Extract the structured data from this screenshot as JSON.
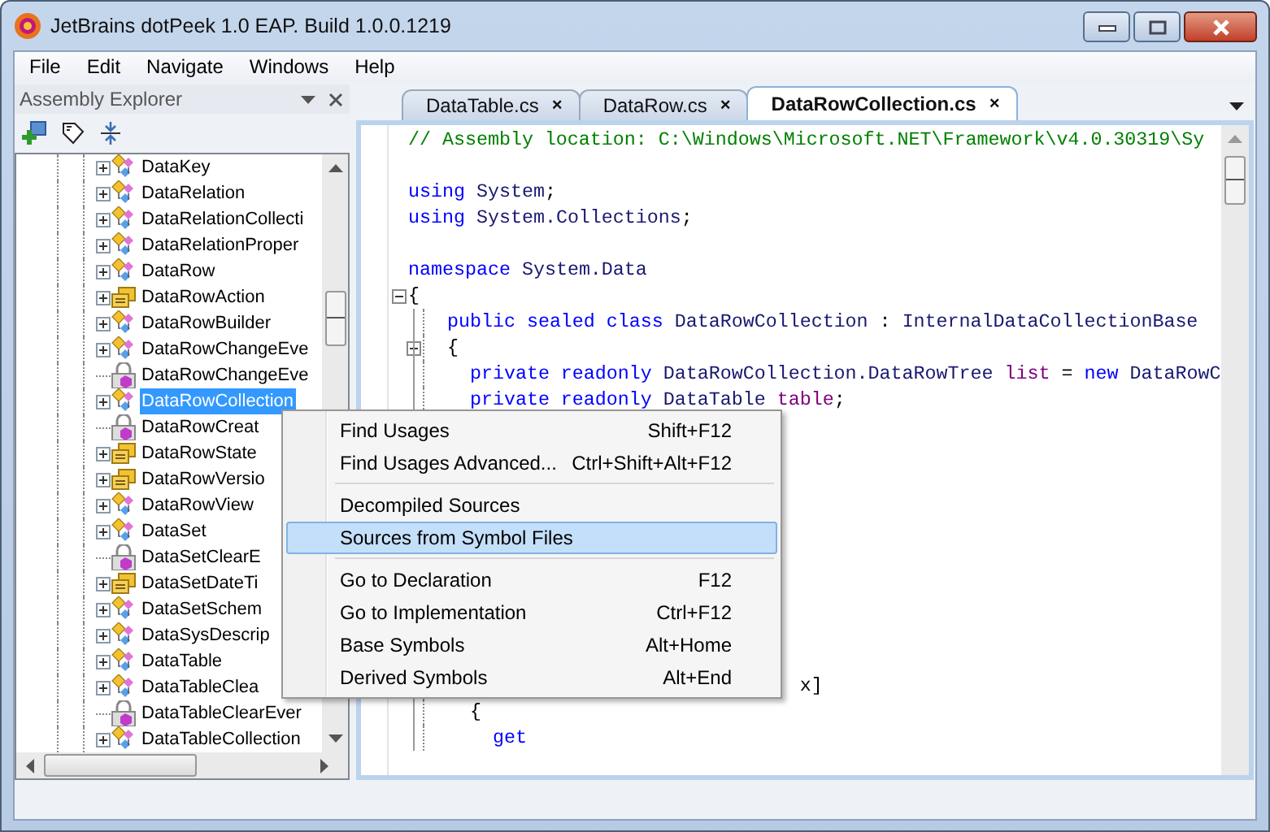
{
  "window": {
    "title": "JetBrains dotPeek 1.0 EAP. Build 1.0.0.1219"
  },
  "menu_bar": [
    "File",
    "Edit",
    "Navigate",
    "Windows",
    "Help"
  ],
  "assembly_explorer": {
    "title": "Assembly Explorer",
    "tree": [
      {
        "label": "DataKey",
        "kind": "class",
        "expandable": true,
        "selected": false
      },
      {
        "label": "DataRelation",
        "kind": "class",
        "expandable": true,
        "selected": false
      },
      {
        "label": "DataRelationCollecti",
        "kind": "class",
        "expandable": true,
        "selected": false
      },
      {
        "label": "DataRelationProper",
        "kind": "class",
        "expandable": true,
        "selected": false
      },
      {
        "label": "DataRow",
        "kind": "class",
        "expandable": true,
        "selected": false
      },
      {
        "label": "DataRowAction",
        "kind": "enum",
        "expandable": true,
        "selected": false
      },
      {
        "label": "DataRowBuilder",
        "kind": "class",
        "expandable": true,
        "selected": false
      },
      {
        "label": "DataRowChangeEve",
        "kind": "class",
        "expandable": true,
        "selected": false
      },
      {
        "label": "DataRowChangeEve",
        "kind": "delegate",
        "expandable": false,
        "selected": false
      },
      {
        "label": "DataRowCollection",
        "kind": "class",
        "expandable": true,
        "selected": true
      },
      {
        "label": "DataRowCreat",
        "kind": "delegate",
        "expandable": false,
        "selected": false
      },
      {
        "label": "DataRowState",
        "kind": "enum",
        "expandable": true,
        "selected": false
      },
      {
        "label": "DataRowVersio",
        "kind": "enum",
        "expandable": true,
        "selected": false
      },
      {
        "label": "DataRowView",
        "kind": "class",
        "expandable": true,
        "selected": false
      },
      {
        "label": "DataSet",
        "kind": "class",
        "expandable": true,
        "selected": false
      },
      {
        "label": "DataSetClearE",
        "kind": "delegate",
        "expandable": false,
        "selected": false
      },
      {
        "label": "DataSetDateTi",
        "kind": "enum",
        "expandable": true,
        "selected": false
      },
      {
        "label": "DataSetSchem",
        "kind": "class",
        "expandable": true,
        "selected": false
      },
      {
        "label": "DataSysDescrip",
        "kind": "class",
        "expandable": true,
        "selected": false
      },
      {
        "label": "DataTable",
        "kind": "class",
        "expandable": true,
        "selected": false
      },
      {
        "label": "DataTableClea",
        "kind": "class",
        "expandable": true,
        "selected": false
      },
      {
        "label": "DataTableClearEver",
        "kind": "delegate",
        "expandable": false,
        "selected": false
      },
      {
        "label": "DataTableCollection",
        "kind": "class",
        "expandable": true,
        "selected": false
      }
    ]
  },
  "tabs": [
    {
      "label": "DataTable.cs",
      "close": "×",
      "selected": false
    },
    {
      "label": "DataRow.cs",
      "close": "×",
      "selected": false
    },
    {
      "label": "DataRowCollection.cs",
      "close": "×",
      "selected": true
    }
  ],
  "code_lines": [
    {
      "kind": "code",
      "tokens": [
        {
          "t": "// Assembly location: C:\\Windows\\Microsoft.NET\\Framework\\v4.0.30319\\Sy",
          "kind": "comment"
        }
      ]
    },
    {
      "kind": "blank"
    },
    {
      "kind": "code",
      "tokens": [
        {
          "t": "using",
          "kind": "keyword"
        },
        {
          "t": " System",
          "kind": "type"
        },
        {
          "t": ";",
          "kind": "plain"
        }
      ]
    },
    {
      "kind": "code",
      "tokens": [
        {
          "t": "using",
          "kind": "keyword"
        },
        {
          "t": " System.Collections",
          "kind": "type"
        },
        {
          "t": ";",
          "kind": "plain"
        }
      ]
    },
    {
      "kind": "blank"
    },
    {
      "kind": "code",
      "tokens": [
        {
          "t": "namespace",
          "kind": "keyword"
        },
        {
          "t": " System.Data",
          "kind": "type"
        }
      ]
    },
    {
      "kind": "code",
      "fold": true,
      "tokens": [
        {
          "t": "{",
          "kind": "plain"
        }
      ]
    },
    {
      "kind": "code",
      "tokens": [
        {
          "t": "  public sealed class",
          "kind": "keyword"
        },
        {
          "t": " DataRowCollection",
          "kind": "type"
        },
        {
          "t": " : ",
          "kind": "plain"
        },
        {
          "t": "InternalDataCollectionBase",
          "kind": "type"
        }
      ]
    },
    {
      "kind": "code",
      "fold": true,
      "tokens": [
        {
          "t": "  {",
          "kind": "plain"
        }
      ]
    },
    {
      "kind": "code",
      "tokens": [
        {
          "t": "    private readonly",
          "kind": "keyword"
        },
        {
          "t": " DataRowCollection.DataRowTree",
          "kind": "type"
        },
        {
          "t": " list",
          "kind": "field"
        },
        {
          "t": " = ",
          "kind": "plain"
        },
        {
          "t": "new",
          "kind": "keyword"
        },
        {
          "t": " DataRowC",
          "kind": "type"
        }
      ]
    },
    {
      "kind": "code",
      "tokens": [
        {
          "t": "    private readonly",
          "kind": "keyword"
        },
        {
          "t": " DataTable",
          "kind": "type"
        },
        {
          "t": " table",
          "kind": "field"
        },
        {
          "t": ";",
          "kind": "plain"
        }
      ]
    },
    {
      "kind": "blank"
    },
    {
      "kind": "blank"
    },
    {
      "kind": "blank"
    },
    {
      "kind": "blank"
    },
    {
      "kind": "blank"
    },
    {
      "kind": "blank"
    },
    {
      "kind": "blank"
    },
    {
      "kind": "blank"
    },
    {
      "kind": "blank"
    },
    {
      "kind": "blank"
    },
    {
      "kind": "code",
      "tokens": [
        {
          "t": "                                 x]",
          "kind": "plain"
        }
      ]
    },
    {
      "kind": "code",
      "tokens": [
        {
          "t": "    {",
          "kind": "plain"
        }
      ]
    },
    {
      "kind": "code",
      "tokens": [
        {
          "t": "      get",
          "kind": "keyword"
        }
      ]
    }
  ],
  "context_menu": [
    {
      "kind": "item",
      "label": "Find Usages",
      "shortcut": "Shift+F12",
      "selected": false
    },
    {
      "kind": "item",
      "label": "Find Usages Advanced...",
      "shortcut": "Ctrl+Shift+Alt+F12",
      "selected": false
    },
    {
      "kind": "separator"
    },
    {
      "kind": "item",
      "label": "Decompiled Sources",
      "selected": false
    },
    {
      "kind": "item",
      "label": "Sources from Symbol Files",
      "selected": true
    },
    {
      "kind": "separator"
    },
    {
      "kind": "item",
      "label": "Go to Declaration",
      "shortcut": "F12",
      "selected": false
    },
    {
      "kind": "item",
      "label": "Go to Implementation",
      "shortcut": "Ctrl+F12",
      "selected": false
    },
    {
      "kind": "item",
      "label": "Base Symbols",
      "shortcut": "Alt+Home",
      "selected": false
    },
    {
      "kind": "item",
      "label": "Derived Symbols",
      "shortcut": "Alt+End",
      "selected": false
    }
  ]
}
